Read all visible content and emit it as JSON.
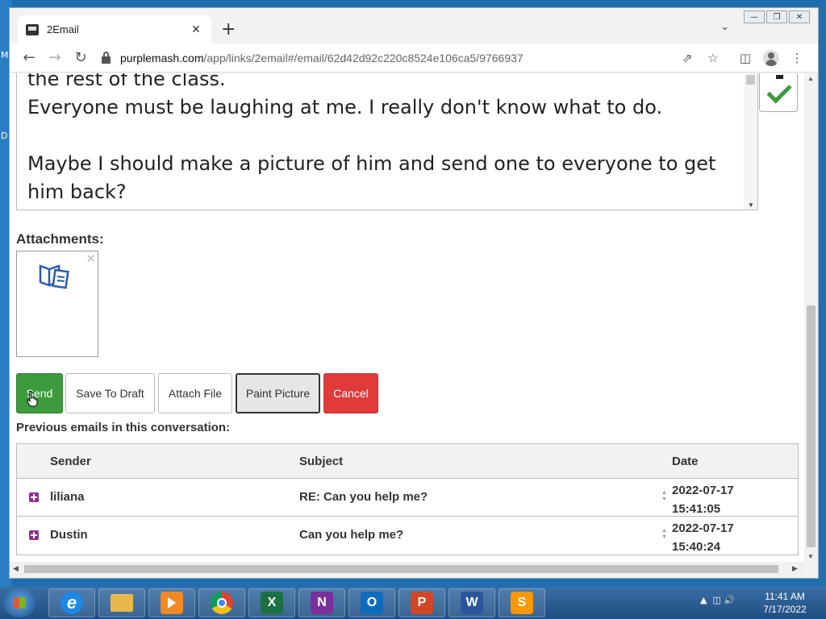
{
  "desktop": {
    "edge_letters": [
      "M",
      "D"
    ]
  },
  "browser": {
    "tab_title": "2Email",
    "url_host": "purplemash.com",
    "url_path": "/app/links/2email#/email/62d42d92c220c8524e106ca5/9766937"
  },
  "message": {
    "lines": [
      "the rest of the class.",
      "Everyone must be laughing at me. I really don't know what to do.",
      "",
      "Maybe I should make a picture of him and send one to everyone to get him back?"
    ]
  },
  "attachments": {
    "label": "Attachments:"
  },
  "actions": {
    "send": "Send",
    "save_draft": "Save To Draft",
    "attach_file": "Attach File",
    "paint_picture": "Paint Picture",
    "cancel": "Cancel"
  },
  "conversation": {
    "label": "Previous emails in this conversation:",
    "columns": {
      "sender": "Sender",
      "subject": "Subject",
      "date": "Date"
    },
    "rows": [
      {
        "sender": "liliana",
        "subject": "RE: Can you help me?",
        "date": "2022-07-17",
        "time": "15:41:05"
      },
      {
        "sender": "Dustin",
        "subject": "Can you help me?",
        "date": "2022-07-17",
        "time": "15:40:24"
      }
    ]
  },
  "taskbar": {
    "apps": [
      {
        "name": "Internet Explorer",
        "icon": "ie-icon",
        "color": "#1e88e5",
        "glyph": "e"
      },
      {
        "name": "File Explorer",
        "icon": "folder-icon",
        "color": "#e8b94a",
        "glyph": ""
      },
      {
        "name": "Media Player",
        "icon": "media-icon",
        "color": "#f08a24",
        "glyph": ""
      },
      {
        "name": "Chrome",
        "icon": "chrome-icon",
        "color": "#db4437",
        "glyph": ""
      },
      {
        "name": "Excel",
        "icon": "excel-icon",
        "color": "#1d7044",
        "glyph": "X"
      },
      {
        "name": "OneNote",
        "icon": "onenote-icon",
        "color": "#7b2f9a",
        "glyph": "N"
      },
      {
        "name": "Outlook",
        "icon": "outlook-icon",
        "color": "#0f6cbd",
        "glyph": "O"
      },
      {
        "name": "PowerPoint",
        "icon": "powerpoint-icon",
        "color": "#d24726",
        "glyph": "P"
      },
      {
        "name": "Word",
        "icon": "word-icon",
        "color": "#2b579a",
        "glyph": "W"
      },
      {
        "name": "Sublime Text",
        "icon": "sublime-icon",
        "color": "#ff9800",
        "glyph": "S"
      }
    ],
    "time": "11:41 AM",
    "date": "7/17/2022"
  }
}
